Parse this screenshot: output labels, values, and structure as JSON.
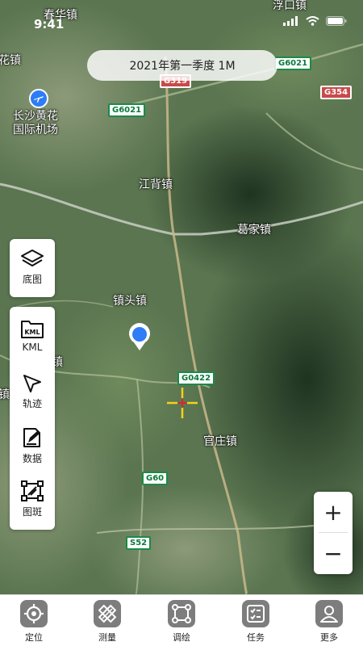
{
  "status_bar": {
    "time": "9:41"
  },
  "map": {
    "season_label": "2021年第一季度 1M",
    "places": [
      {
        "id": "chunhua",
        "name": "春华镇"
      },
      {
        "id": "fukou",
        "name": "浮口镇"
      },
      {
        "id": "hua",
        "name": "花镇"
      },
      {
        "id": "airport",
        "name": "长沙黄花\n国际机场"
      },
      {
        "id": "jiangbei",
        "name": "江背镇"
      },
      {
        "id": "gejia",
        "name": "葛家镇"
      },
      {
        "id": "zhentou",
        "name": "镇头镇"
      },
      {
        "id": "xianhuang",
        "name": "仙黄镇"
      },
      {
        "id": "guanzhuang",
        "name": "官庄镇"
      },
      {
        "id": "jin",
        "name": "镇"
      }
    ],
    "road_shields": [
      {
        "id": "g6021a",
        "label": "G6021",
        "type": "g"
      },
      {
        "id": "g6021b",
        "label": "G6021",
        "type": "g"
      },
      {
        "id": "g319",
        "label": "G319",
        "type": "r"
      },
      {
        "id": "g354",
        "label": "G354",
        "type": "r"
      },
      {
        "id": "g0422",
        "label": "G0422",
        "type": "g"
      },
      {
        "id": "g60",
        "label": "G60",
        "type": "g"
      },
      {
        "id": "s52",
        "label": "S52",
        "type": "g"
      }
    ]
  },
  "left_tools": {
    "basemap": {
      "label": "底图",
      "icon": "layers-icon"
    },
    "kml": {
      "label": "KML",
      "icon": "kml-folder-icon"
    },
    "track": {
      "label": "轨迹",
      "icon": "cursor-arrow-icon"
    },
    "data": {
      "label": "数据",
      "icon": "edit-document-icon"
    },
    "patch": {
      "label": "图斑",
      "icon": "polygon-icon"
    }
  },
  "zoom": {
    "in": "+",
    "out": "−"
  },
  "tabs": [
    {
      "label": "定位",
      "icon": "locate-icon"
    },
    {
      "label": "测量",
      "icon": "measure-icon"
    },
    {
      "label": "调绘",
      "icon": "survey-draw-icon"
    },
    {
      "label": "任务",
      "icon": "task-list-icon"
    },
    {
      "label": "更多",
      "icon": "user-more-icon"
    }
  ],
  "colors": {
    "accent_blue": "#2e7cf6",
    "crosshair": "#f2d21b",
    "crosshair_center": "#e0242b",
    "tab_icon_bg": "#7d7d7d"
  }
}
